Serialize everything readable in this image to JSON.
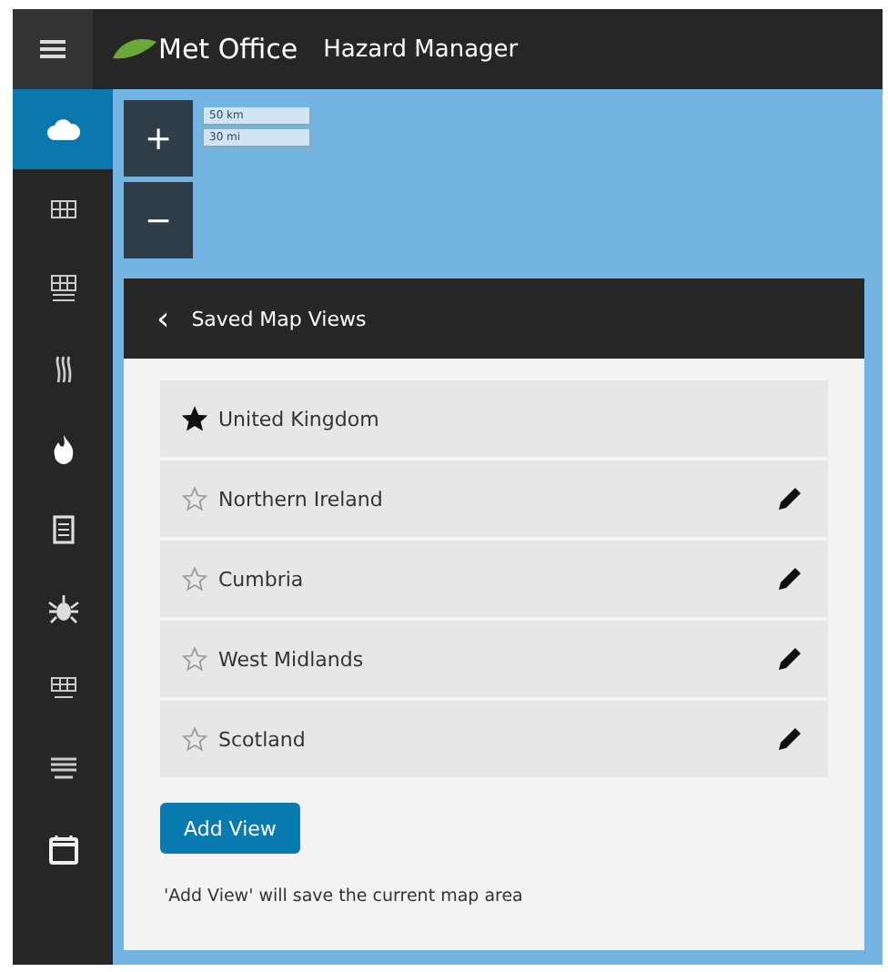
{
  "header": {
    "logo": "Met Office",
    "title": "Hazard Manager"
  },
  "sidebar": {
    "items": [
      {
        "kind": "cloud",
        "selected": true
      },
      {
        "kind": "grid",
        "selected": false
      },
      {
        "kind": "grid-tall",
        "selected": false
      },
      {
        "kind": "heat",
        "selected": false
      },
      {
        "kind": "fire",
        "selected": false
      },
      {
        "kind": "document",
        "selected": false
      },
      {
        "kind": "bug",
        "selected": false
      },
      {
        "kind": "grid-small",
        "selected": false
      },
      {
        "kind": "lines",
        "selected": false
      },
      {
        "kind": "calendar",
        "selected": false
      }
    ]
  },
  "map": {
    "scale": [
      "50 km",
      "30 mi"
    ],
    "zoom": [
      "+",
      "−"
    ]
  },
  "panel": {
    "title": "Saved Map Views",
    "back": "‹",
    "views": [
      {
        "name": "United Kingdom",
        "favourite": true,
        "editable": false
      },
      {
        "name": "Northern Ireland",
        "favourite": false,
        "editable": true
      },
      {
        "name": "Cumbria",
        "favourite": false,
        "editable": true
      },
      {
        "name": "West Midlands",
        "favourite": false,
        "editable": true
      },
      {
        "name": "Scotland",
        "favourite": false,
        "editable": true
      }
    ],
    "button": "Add View",
    "note": "'Add View' will save the current map area"
  }
}
